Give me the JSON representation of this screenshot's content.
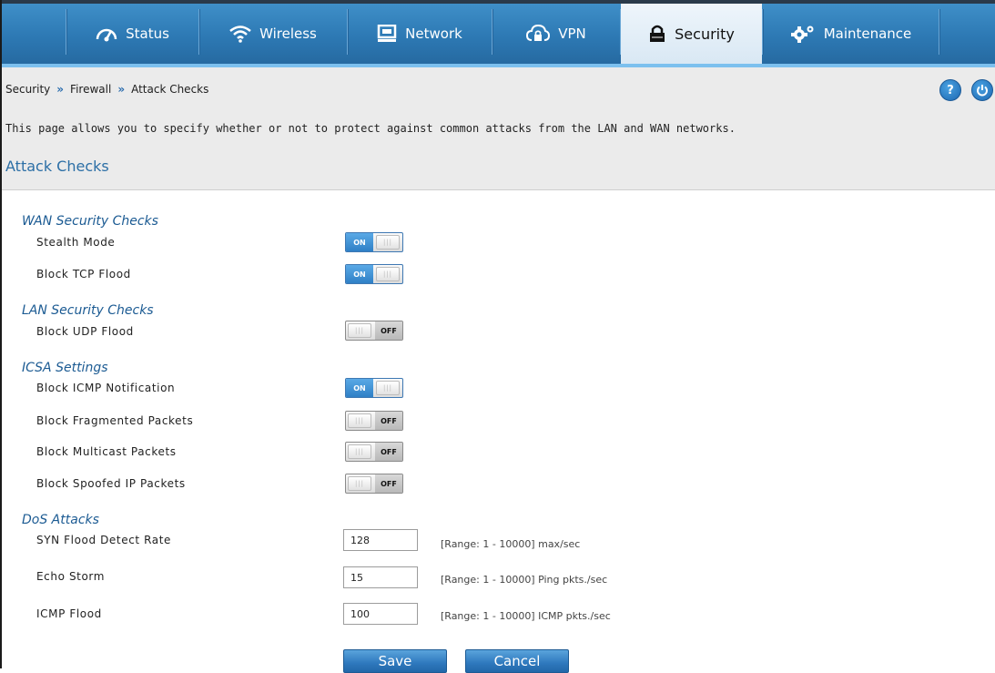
{
  "nav": {
    "items": [
      {
        "label": "Status",
        "icon": "gauge-icon"
      },
      {
        "label": "Wireless",
        "icon": "wifi-icon"
      },
      {
        "label": "Network",
        "icon": "monitor-icon"
      },
      {
        "label": "VPN",
        "icon": "cloud-lock-icon"
      },
      {
        "label": "Security",
        "icon": "lock-icon",
        "active": true
      },
      {
        "label": "Maintenance",
        "icon": "gears-icon"
      }
    ]
  },
  "breadcrumb": {
    "items": [
      "Security",
      "Firewall",
      "Attack Checks"
    ],
    "separator": "»"
  },
  "help_label": "?",
  "intro_text": "This page allows you to specify whether or not to protect against common attacks from the LAN and WAN networks.",
  "page_heading": "Attack Checks",
  "sections": {
    "wan": {
      "title": "WAN Security Checks",
      "rows": [
        {
          "label": "Stealth Mode",
          "state": "ON"
        },
        {
          "label": "Block TCP Flood",
          "state": "ON"
        }
      ]
    },
    "lan": {
      "title": "LAN Security Checks",
      "rows": [
        {
          "label": "Block UDP Flood",
          "state": "OFF"
        }
      ]
    },
    "icsa": {
      "title": "ICSA Settings",
      "rows": [
        {
          "label": "Block ICMP Notification",
          "state": "ON"
        },
        {
          "label": "Block Fragmented Packets",
          "state": "OFF"
        },
        {
          "label": "Block Multicast Packets",
          "state": "OFF"
        },
        {
          "label": "Block Spoofed IP Packets",
          "state": "OFF"
        }
      ]
    },
    "dos": {
      "title": "DoS Attacks",
      "rows": [
        {
          "label": "SYN Flood Detect Rate",
          "value": "128",
          "hint": "[Range: 1 - 10000] max/sec"
        },
        {
          "label": "Echo Storm",
          "value": "15",
          "hint": "[Range: 1 - 10000] Ping pkts./sec"
        },
        {
          "label": "ICMP Flood",
          "value": "100",
          "hint": "[Range: 1 - 10000] ICMP pkts./sec"
        }
      ]
    }
  },
  "actions": {
    "save_label": "Save",
    "cancel_label": "Cancel"
  },
  "colors": {
    "nav_blue": "#2d79b4",
    "accent_blue": "#2c6fa6",
    "toggle_on": "#2f80c6"
  }
}
